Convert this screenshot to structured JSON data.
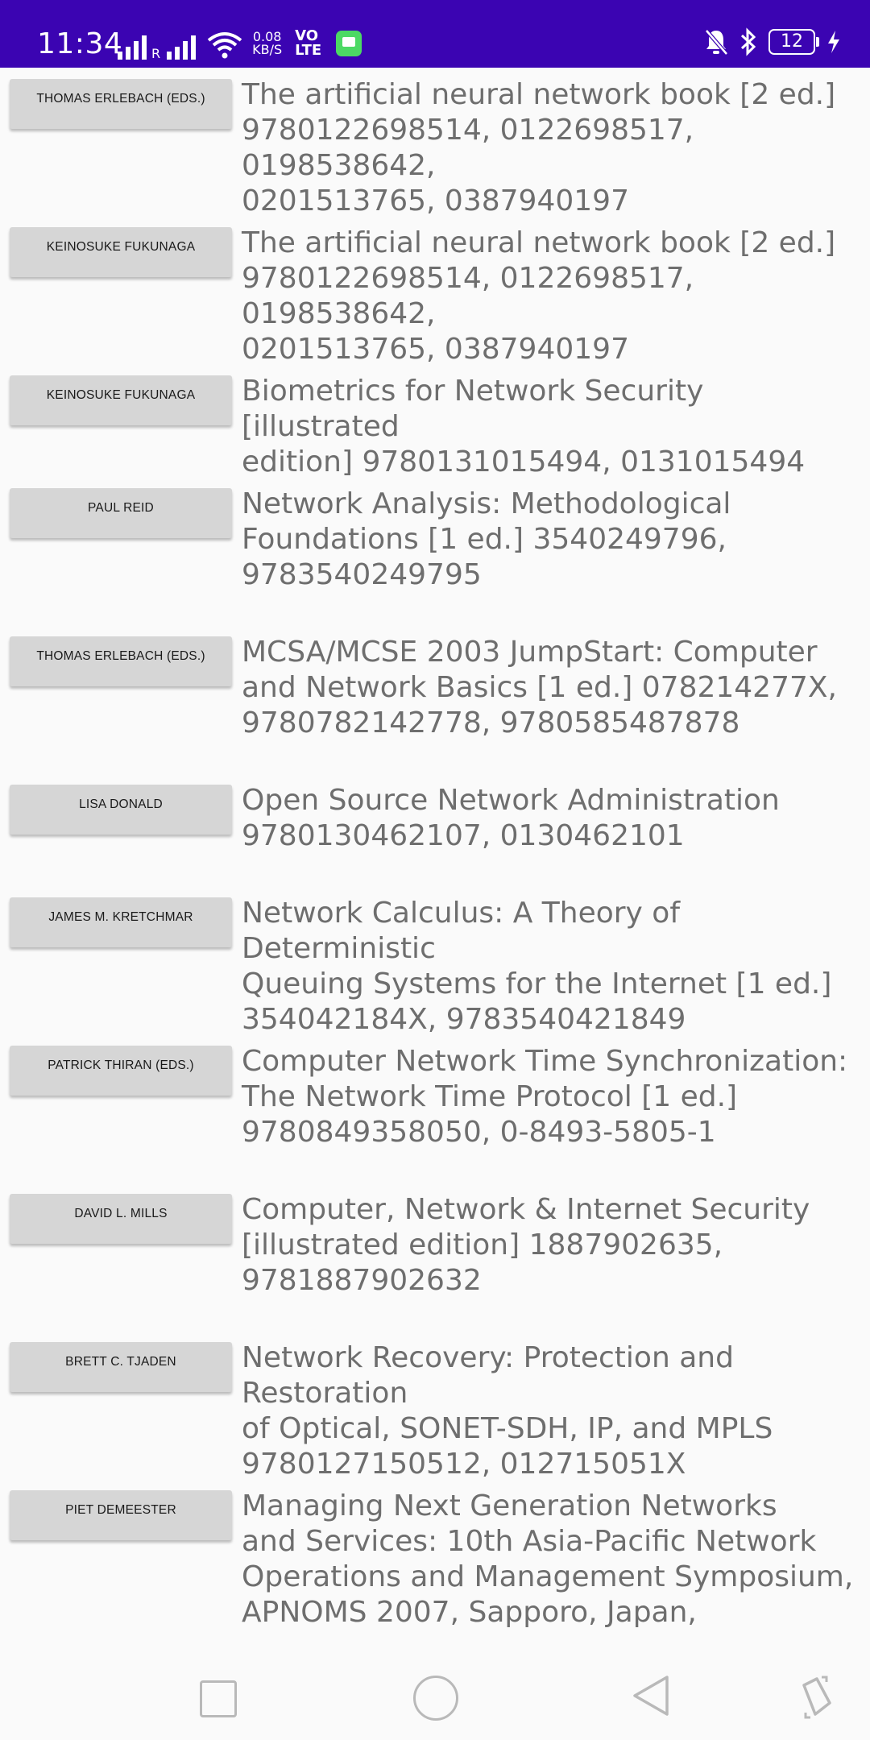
{
  "status_bar": {
    "time": "11:34",
    "roaming_label": "R",
    "net_speed_value": "0.08",
    "net_speed_unit": "KB/S",
    "volte_top": "VO",
    "volte_bottom": "LTE",
    "battery_level": "12"
  },
  "books": [
    {
      "author": "THOMAS ERLEBACH (EDS.)",
      "title": "The artificial neural network book [2 ed.]\n9780122698514, 0122698517, 0198538642,\n0201513765, 0387940197"
    },
    {
      "author": "KEINOSUKE FUKUNAGA",
      "title": "The artificial neural network book [2 ed.]\n9780122698514, 0122698517, 0198538642,\n0201513765, 0387940197"
    },
    {
      "author": "KEINOSUKE FUKUNAGA",
      "title": "Biometrics for Network Security [illustrated\nedition] 9780131015494, 0131015494"
    },
    {
      "author": "PAUL REID",
      "title": "Network Analysis: Methodological\nFoundations [1 ed.] 3540249796,\n9783540249795"
    },
    {
      "author": "THOMAS ERLEBACH (EDS.)",
      "title": "MCSA/MCSE 2003 JumpStart: Computer\nand Network Basics [1 ed.] 078214277X,\n9780782142778, 9780585487878"
    },
    {
      "author": "LISA DONALD",
      "title": "Open Source Network Administration\n9780130462107, 0130462101"
    },
    {
      "author": "JAMES M. KRETCHMAR",
      "title": "Network Calculus: A Theory of Deterministic\nQueuing Systems for the Internet [1 ed.]\n354042184X, 9783540421849"
    },
    {
      "author": "PATRICK THIRAN (EDS.)",
      "title": "Computer Network Time Synchronization:\nThe Network Time Protocol [1 ed.]\n9780849358050, 0-8493-5805-1"
    },
    {
      "author": "DAVID L. MILLS",
      "title": "Computer, Network & Internet Security\n[illustrated edition] 1887902635,\n9781887902632"
    },
    {
      "author": "BRETT C. TJADEN",
      "title": "Network Recovery: Protection and Restoration\nof Optical, SONET-SDH, IP, and MPLS\n9780127150512, 012715051X"
    },
    {
      "author": "PIET DEMEESTER",
      "title": "Managing Next Generation Networks\nand Services: 10th Asia-Pacific Network\nOperations and Management Symposium,\nAPNOMS 2007, Sapporo, Japan,"
    }
  ],
  "nav_bar": {
    "recents_icon": "square-icon",
    "home_icon": "circle-icon",
    "back_icon": "triangle-back-icon",
    "rotate_icon": "rotate-icon"
  },
  "colors": {
    "status_bar": "#3b04b2",
    "background": "#fafafa",
    "button": "#d6d6d6",
    "title_text": "#6e6e6e"
  }
}
